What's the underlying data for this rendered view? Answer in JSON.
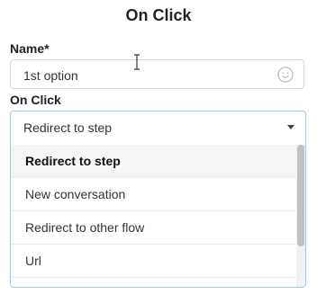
{
  "dialog": {
    "title": "On Click"
  },
  "name_field": {
    "label": "Name*",
    "value": "1st option",
    "icon": "emoji-smile-icon"
  },
  "onclick_field": {
    "label": "On Click",
    "selected_value": "Redirect to step",
    "options": [
      {
        "label": "Redirect to step",
        "selected": true
      },
      {
        "label": "New conversation",
        "selected": false
      },
      {
        "label": "Redirect to other flow",
        "selected": false
      },
      {
        "label": "Url",
        "selected": false
      }
    ]
  },
  "colors": {
    "focus_border": "#9fcbe0",
    "selected_option_bg": "#f5f5f5"
  }
}
